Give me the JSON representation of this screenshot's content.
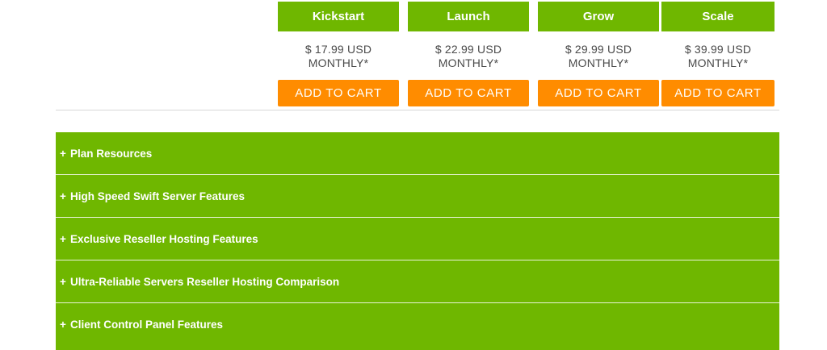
{
  "plans": [
    {
      "name": "Kickstart",
      "price": "$ 17.99 USD",
      "period": "MONTHLY*",
      "button": "ADD TO CART"
    },
    {
      "name": "Launch",
      "price": "$ 22.99 USD",
      "period": "MONTHLY*",
      "button": "ADD TO CART"
    },
    {
      "name": "Grow",
      "price": "$ 29.99 USD",
      "period": "MONTHLY*",
      "button": "ADD TO CART"
    },
    {
      "name": "Scale",
      "price": "$ 39.99 USD",
      "period": "MONTHLY*",
      "button": "ADD TO CART"
    }
  ],
  "accordion": [
    {
      "icon": "+",
      "label": "Plan Resources"
    },
    {
      "icon": "+",
      "label": "High Speed Swift Server Features"
    },
    {
      "icon": "+",
      "label": "Exclusive Reseller Hosting Features"
    },
    {
      "icon": "+",
      "label": "Ultra-Reliable Servers Reseller Hosting Comparison"
    },
    {
      "icon": "+",
      "label": "Client Control Panel Features"
    }
  ],
  "colors": {
    "brand_green": "#6fb700",
    "cta_orange": "#ff8c00",
    "price_text": "#4a4a4a"
  }
}
